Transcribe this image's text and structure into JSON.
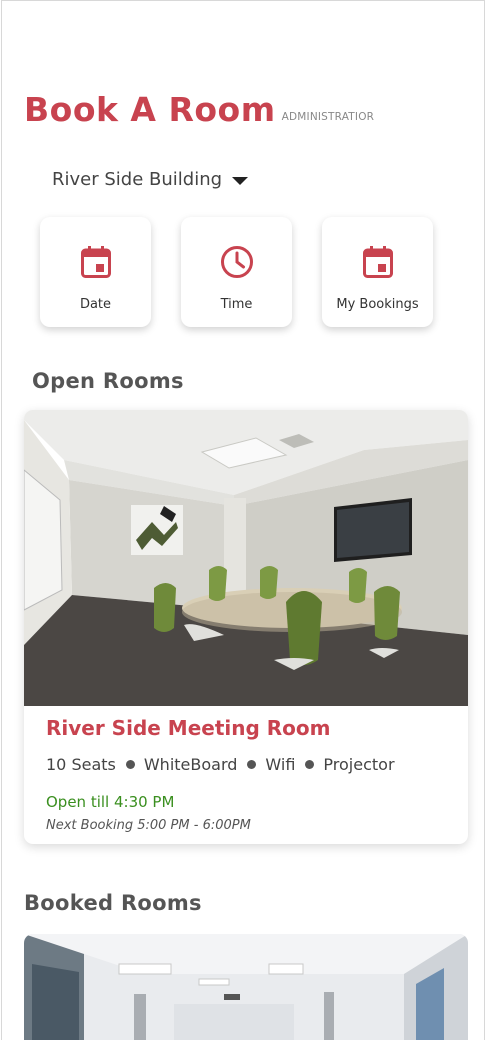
{
  "header": {
    "title": "Book A Room",
    "role": "ADMINISTRATIOR"
  },
  "building_selector": {
    "value": "River Side Building"
  },
  "quick_actions": [
    {
      "label": "Date",
      "icon": "calendar-icon"
    },
    {
      "label": "Time",
      "icon": "clock-icon"
    },
    {
      "label": "My Bookings",
      "icon": "calendar-icon"
    }
  ],
  "open_rooms": {
    "heading": "Open Rooms",
    "rooms": [
      {
        "name": "River Side Meeting Room",
        "amenities": [
          "10 Seats",
          "WhiteBoard",
          "Wifi",
          "Projector"
        ],
        "status": "Open till 4:30 PM",
        "next_booking": "Next Booking 5:00 PM - 6:00PM"
      }
    ]
  },
  "booked_rooms": {
    "heading": "Booked Rooms"
  },
  "colors": {
    "accent": "#c8434f",
    "open_status": "#3a8f1f"
  }
}
